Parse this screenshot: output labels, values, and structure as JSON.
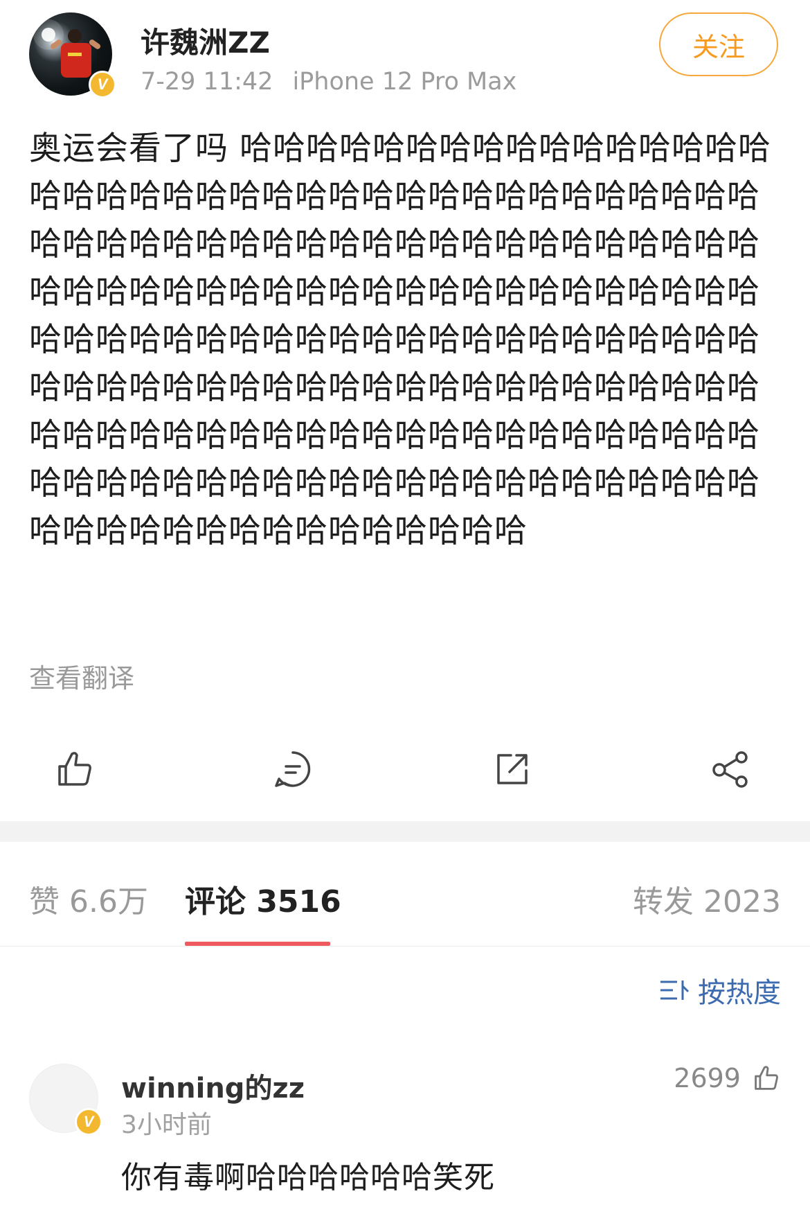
{
  "post": {
    "author": "许魏洲ZZ",
    "time": "7-29 11:42",
    "device": "iPhone 12 Pro Max",
    "follow_label": "关注",
    "verified_mark": "V",
    "content": "奥运会看了吗 哈哈哈哈哈哈哈哈哈哈哈哈哈哈哈哈哈哈哈哈哈哈哈哈哈哈哈哈哈哈哈哈哈哈哈哈哈哈哈哈哈哈哈哈哈哈哈哈哈哈哈哈哈哈哈哈哈哈哈哈哈哈哈哈哈哈哈哈哈哈哈哈哈哈哈哈哈哈哈哈哈哈哈哈哈哈哈哈哈哈哈哈哈哈哈哈哈哈哈哈哈哈哈哈哈哈哈哈哈哈哈哈哈哈哈哈哈哈哈哈哈哈哈哈哈哈哈哈哈哈哈哈哈哈哈哈哈哈哈哈哈哈哈哈哈哈哈哈哈哈哈哈哈哈哈哈哈哈哈哈哈哈哈哈哈哈哈哈哈哈哈哈哈哈哈哈哈哈哈哈哈哈哈哈哈",
    "translate_label": "查看翻译"
  },
  "actions": {
    "icons": [
      "thumbs-up-icon",
      "comment-icon",
      "repost-icon",
      "share-icon"
    ]
  },
  "tabs": {
    "likes": "赞 6.6万",
    "comments": "评论 3516",
    "reposts": "转发 2023"
  },
  "sort": {
    "label": "按热度"
  },
  "comment": {
    "user": "winning的zz",
    "time": "3小时前",
    "likes": "2699",
    "text": "你有毒啊哈哈哈哈哈哈笑死",
    "verified_mark": "V"
  },
  "colors": {
    "follow": "#f79a1e",
    "tab_underline": "#ef5a5f",
    "sort_link": "#3d6bb0",
    "badge": "#f3b82f"
  }
}
